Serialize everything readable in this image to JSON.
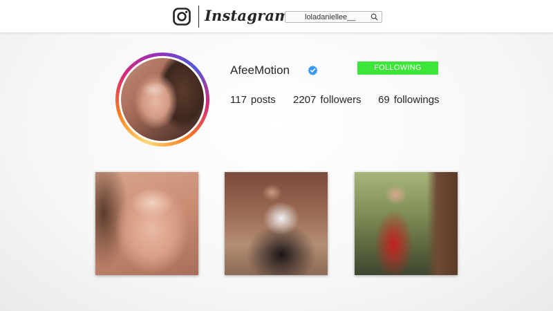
{
  "header": {
    "logo_icon": "instagram-camera-icon",
    "wordmark": "Instagram",
    "search": {
      "value": "loladaniellee__",
      "icon": "search-icon"
    }
  },
  "profile": {
    "username": "AfeeMotion",
    "verified_icon": "verified-badge-icon",
    "follow_button": "FOLLOWING",
    "stats": {
      "posts_count": "117",
      "posts_label": "posts",
      "followers_count": "2207",
      "followers_label": "followers",
      "followings_count": "69",
      "followings_label": "followings"
    }
  },
  "posts": [
    {
      "name": "post-1"
    },
    {
      "name": "post-2"
    },
    {
      "name": "post-3"
    }
  ],
  "colors": {
    "follow_button": "#3ce639",
    "verified": "#3897f0",
    "text": "#262626"
  }
}
